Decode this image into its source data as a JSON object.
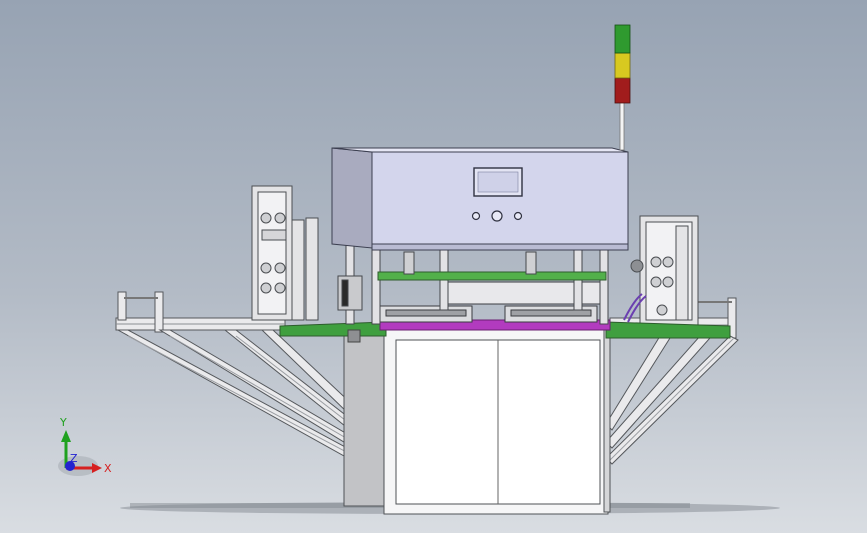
{
  "viewport": {
    "model": "3d-machine-assembly-model",
    "view": "front"
  },
  "colors": {
    "background_top": "#97a3b3",
    "background_bottom": "#d9dde2",
    "housing": "#d3d5ec",
    "frame": "#e7e7ea",
    "green_plate": "#3f9f3f",
    "magenta_plate": "#b23bbf",
    "light_green": "#2f9a2f",
    "light_yellow": "#d8c920",
    "light_red": "#a11c1c",
    "axis_x": "#d62020",
    "axis_y": "#1fa11f",
    "axis_z": "#2323d0"
  },
  "triad": {
    "x_label": "X",
    "y_label": "Y",
    "z_label": "Z"
  }
}
